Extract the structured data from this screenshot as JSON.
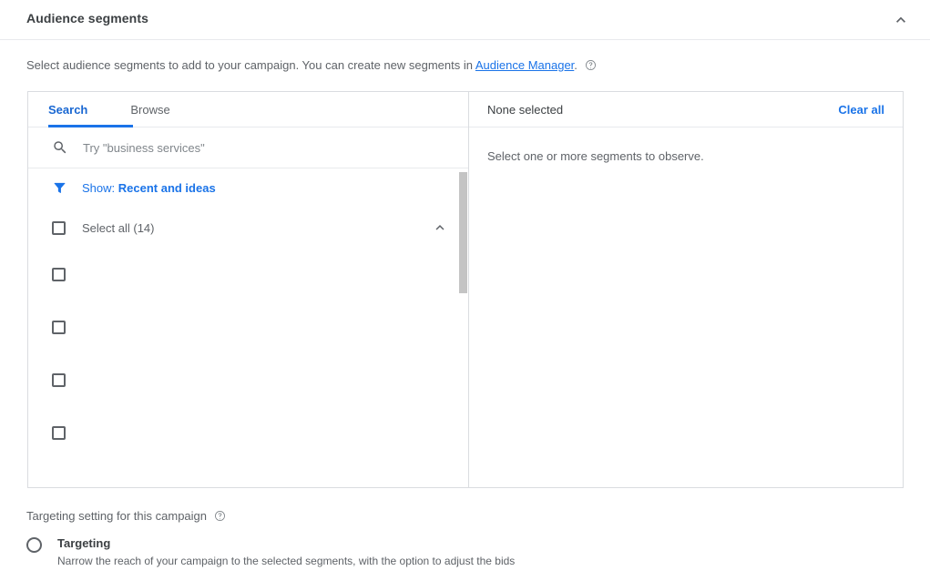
{
  "section": {
    "title": "Audience segments",
    "collapse_icon": "chevron-up-icon",
    "description_prefix": "Select audience segments to add to your campaign. You can create new segments in ",
    "description_link": "Audience Manager",
    "description_suffix": ".",
    "help_icon": "help-circle-icon"
  },
  "picker": {
    "tabs": [
      {
        "label": "Search",
        "active": true
      },
      {
        "label": "Browse",
        "active": false
      }
    ],
    "search": {
      "icon": "search-icon",
      "value": "",
      "placeholder": "Try \"business services\""
    },
    "filter": {
      "icon": "filter-funnel-icon",
      "prefix": "Show: ",
      "value": "Recent and ideas"
    },
    "select_all": {
      "label": "Select all (14)",
      "checked": false,
      "expand_icon": "chevron-up-icon"
    },
    "items": [
      {
        "label": "",
        "checked": false
      },
      {
        "label": "",
        "checked": false
      },
      {
        "label": "",
        "checked": false
      },
      {
        "label": "",
        "checked": false
      }
    ]
  },
  "selected_panel": {
    "title": "None selected",
    "clear_all_label": "Clear all",
    "empty_message": "Select one or more segments to observe."
  },
  "targeting": {
    "label": "Targeting setting for this campaign",
    "help_icon": "help-circle-icon",
    "option": {
      "title": "Targeting",
      "description": "Narrow the reach of your campaign to the selected segments, with the option to adjust the bids",
      "selected": false
    }
  },
  "colors": {
    "accent": "#1a73e8",
    "text_primary": "#3c4043",
    "text_secondary": "#5f6368",
    "border": "#dadce0"
  }
}
